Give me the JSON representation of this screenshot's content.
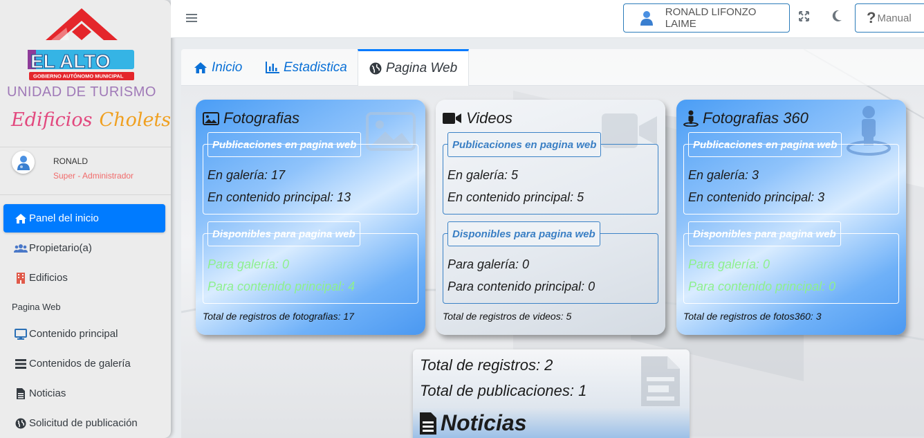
{
  "sidebar": {
    "unit_text": "UNIDAD DE TURISMO",
    "brand_words": [
      "Edificios",
      "Cholets"
    ],
    "logo_text": {
      "title": "EL ALTO",
      "subtitle": "GOBIERNO AUTÓNOMO MUNICIPAL"
    },
    "user": {
      "name": "RONALD",
      "role": "Super - Administrador"
    },
    "items": [
      {
        "label": "Panel del inicio",
        "icon": "home-icon"
      },
      {
        "label": "Propietario(a)",
        "icon": "users-icon"
      },
      {
        "label": "Edificios",
        "icon": "building-icon"
      },
      {
        "label": "Contenido principal",
        "icon": "desktop-icon"
      },
      {
        "label": "Contenidos de galería",
        "icon": "list-icon"
      },
      {
        "label": "Noticias",
        "icon": "file-icon"
      },
      {
        "label": "Solicitud de publicación",
        "icon": "globe-icon"
      }
    ],
    "section_header": "Pagina Web"
  },
  "topbar": {
    "user_button": "RONALD LIFONZO LAIME",
    "manual_button": "Manual"
  },
  "tabs": [
    {
      "label": "Inicio",
      "icon": "home-icon"
    },
    {
      "label": "Estadistica",
      "icon": "chart-bar-icon"
    },
    {
      "label": "Pagina Web",
      "icon": "globe-icon"
    }
  ],
  "cards": [
    {
      "title": "Fotografias",
      "published_legend": "Publicaciones en pagina web",
      "gallery": "En galería: 17",
      "main": "En contenido principal: 13",
      "available_legend": "Disponibles para pagina web",
      "avail_gallery": "Para galería: 0",
      "avail_main": "Para contenido principal: 4",
      "footer": "Total de registros de fotografias: 17"
    },
    {
      "title": "Videos",
      "published_legend": "Publicaciones en pagina web",
      "gallery": "En galería: 5",
      "main": "En contenido principal: 5",
      "available_legend": "Disponibles para pagina web",
      "avail_gallery": "Para galería: 0",
      "avail_main": "Para contenido principal: 0",
      "footer": "Total de registros de videos: 5"
    },
    {
      "title": "Fotografias 360",
      "published_legend": "Publicaciones en pagina web",
      "gallery": "En galería: 3",
      "main": "En contenido principal: 3",
      "available_legend": "Disponibles para pagina web",
      "avail_gallery": "Para galería: 0",
      "avail_main": "Para contenido principal: 0",
      "footer": "Total de registros de fotos360: 3"
    }
  ],
  "news": {
    "total_records": "Total de registros: 2",
    "total_publications": "Total de publicaciones: 1",
    "title": "Noticias"
  },
  "colors": {
    "accent": "#007bff",
    "available_green": "#8ef08e",
    "role_red": "#f16b6b"
  }
}
